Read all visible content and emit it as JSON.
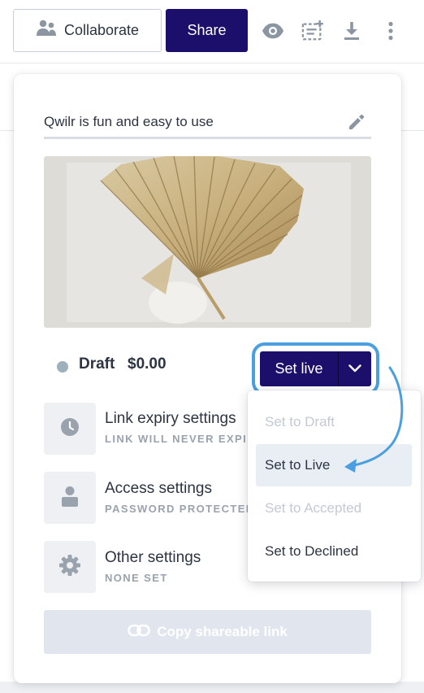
{
  "toolbar": {
    "collaborate_label": "Collaborate",
    "share_label": "Share",
    "icons": [
      "people-icon",
      "eye-icon",
      "checklist-icon",
      "download-icon",
      "more-vertical-icon"
    ]
  },
  "card": {
    "title_value": "Qwilr is fun and easy to use",
    "status": {
      "label": "Draft",
      "price": "$0.00",
      "color": "#9eb0bc"
    },
    "set_live_label": "Set live",
    "settings": [
      {
        "title": "Link expiry settings",
        "subtitle": "LINK WILL NEVER EXPIRE",
        "icon": "clock-icon"
      },
      {
        "title": "Access settings",
        "subtitle": "PASSWORD PROTECTED",
        "icon": "person-icon"
      },
      {
        "title": "Other settings",
        "subtitle": "NONE SET",
        "icon": "gear-icon"
      }
    ],
    "copy_link_label": "Copy shareable link"
  },
  "menu": {
    "items": [
      {
        "label": "Set to Draft",
        "state": "disabled"
      },
      {
        "label": "Set to Live",
        "state": "active"
      },
      {
        "label": "Set to Accepted",
        "state": "disabled"
      },
      {
        "label": "Set to Declined",
        "state": "normal"
      }
    ]
  },
  "colors": {
    "brand": "#1c0e6b",
    "highlight": "#4a9fe0",
    "muted": "#9aa3ad"
  }
}
